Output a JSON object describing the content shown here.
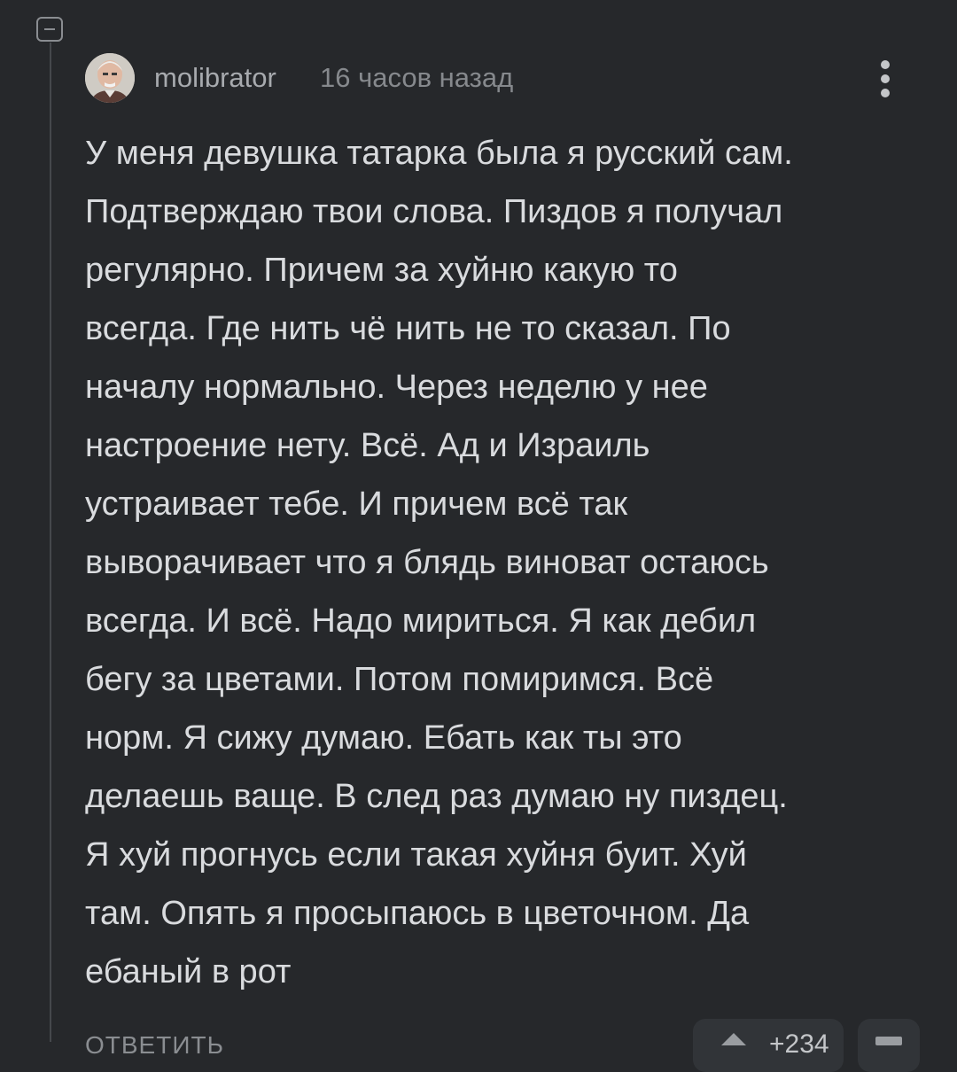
{
  "comment": {
    "author": "molibrator",
    "time": "16 часов назад",
    "text": "У меня девушка татарка была я русский сам.\nПодтверждаю твои слова. Пиздов я получал\nрегулярно. Причем за хуйню какую то\nвсегда. Где нить чё нить не то сказал. По\nначалу нормально. Через неделю у нее\nнастроение нету. Всё. Ад и Израиль\nустраивает тебе. И причем всё так\nвыворачивает что я блядь виноват остаюсь\nвсегда. И всё. Надо мириться. Я как дебил\nбегу за цветами. Потом помиримся. Всё\nнорм. Я сижу думаю. Ебать как ты это\nделаешь ваще. В след раз думаю ну пиздец.\nЯ хуй прогнусь если такая хуйня буит. Хуй\nтам. Опять я просыпаюсь в цветочном. Да\nебаный в рот",
    "reply_label": "ОТВЕТИТЬ",
    "rating": "+234"
  },
  "icons": {
    "collapse": "collapse-minus-icon",
    "more": "more-vertical-icon",
    "upvote": "arrow-up-icon",
    "downvote": "minus-icon"
  },
  "colors": {
    "background": "#26282b",
    "text": "#d9dbde",
    "meta": "#86898d",
    "thread_line": "#45484c"
  }
}
